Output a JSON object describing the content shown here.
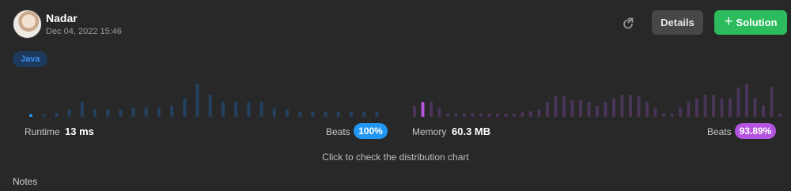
{
  "header": {
    "username": "Nadar",
    "datetime": "Dec 04, 2022 15:46",
    "avatar_icon": "avatar-photo",
    "share_icon": "share-arrow-icon",
    "details_label": "Details",
    "solution_plus": "+",
    "solution_label": "Solution"
  },
  "language_tag": "Java",
  "runtime": {
    "label": "Runtime",
    "value": "13 ms",
    "beats_label": "Beats",
    "beats_value": "100%",
    "color": "#2196f3",
    "distribution": [
      0.08,
      0.08,
      0.12,
      0.22,
      0.45,
      0.22,
      0.22,
      0.22,
      0.28,
      0.28,
      0.28,
      0.34,
      0.56,
      1.0,
      0.67,
      0.45,
      0.45,
      0.45,
      0.45,
      0.28,
      0.22,
      0.16,
      0.16,
      0.16,
      0.16,
      0.16,
      0.16,
      0.16
    ],
    "highlight_index": 0
  },
  "memory": {
    "label": "Memory",
    "value": "60.3 MB",
    "beats_label": "Beats",
    "beats_value": "93.89%",
    "color": "#b355e0",
    "distribution": [
      0.34,
      0.45,
      0.45,
      0.28,
      0.1,
      0.1,
      0.1,
      0.1,
      0.1,
      0.1,
      0.1,
      0.1,
      0.1,
      0.14,
      0.17,
      0.22,
      0.45,
      0.62,
      0.62,
      0.5,
      0.5,
      0.45,
      0.34,
      0.45,
      0.56,
      0.67,
      0.67,
      0.62,
      0.45,
      0.28,
      0.1,
      0.1,
      0.28,
      0.45,
      0.56,
      0.67,
      0.67,
      0.56,
      0.56,
      0.89,
      1.0,
      0.56,
      0.34,
      0.9,
      0.1
    ],
    "highlight_index": 1
  },
  "distribution_hint": "Click to check the distribution chart",
  "notes_label": "Notes"
}
